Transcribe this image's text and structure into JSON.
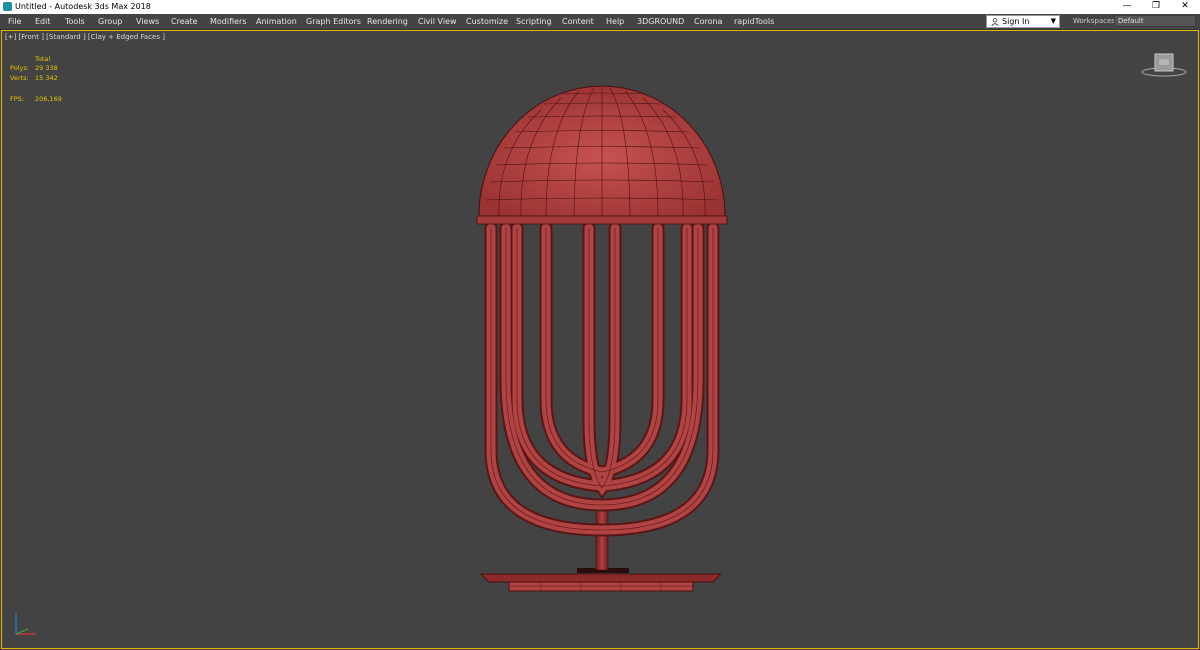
{
  "window": {
    "title": "Untitled - Autodesk 3ds Max 2018",
    "controls": [
      "—",
      "❐",
      "✕"
    ]
  },
  "menu": [
    {
      "label": "File"
    },
    {
      "label": "Edit"
    },
    {
      "label": "Tools"
    },
    {
      "label": "Group"
    },
    {
      "label": "Views"
    },
    {
      "label": "Create"
    },
    {
      "label": "Modifiers"
    },
    {
      "label": "Animation"
    },
    {
      "label": "Graph Editors"
    },
    {
      "label": "Rendering"
    },
    {
      "label": "Civil View"
    },
    {
      "label": "Customize"
    },
    {
      "label": "Scripting"
    },
    {
      "label": "Content"
    },
    {
      "label": "Help"
    },
    {
      "label": "3DGROUND"
    },
    {
      "label": "Corona"
    },
    {
      "label": "rapidTools"
    }
  ],
  "account": {
    "sign_in_label": "Sign In",
    "workspaces_label": "Workspaces:",
    "workspace_value": "Default"
  },
  "viewport": {
    "label": "[+] [Front ] [Standard ] [Clay + Edged Faces ]",
    "stats": {
      "header": "Total",
      "polys_label": "Polys:",
      "polys_value": "29 338",
      "verts_label": "Verts:",
      "verts_value": "15 342",
      "fps_label": "FPS:",
      "fps_value": "206,169"
    }
  },
  "colors": {
    "viewport_bg": "#434343",
    "active_border": "#e8b400",
    "stats_text": "#e8c800",
    "model_fill": "#b04343",
    "model_edges": "#5a1010"
  },
  "icons": {
    "app": "3dsmax-app-icon",
    "account": "person-icon",
    "dropdown": "dropdown-arrow-icon",
    "navigation": "viewcube-icon",
    "axis": "axis-tripod-icon"
  }
}
